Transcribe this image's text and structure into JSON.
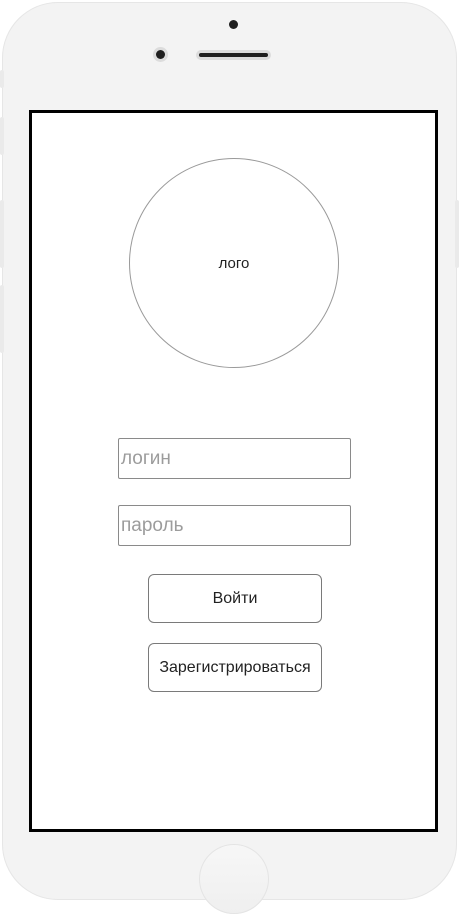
{
  "logo": {
    "text": "лого"
  },
  "login_form": {
    "login_placeholder": "логин",
    "password_placeholder": "пароль",
    "login_value": "",
    "password_value": "",
    "submit_label": "Войти",
    "register_label": "Зарегистрироваться"
  }
}
